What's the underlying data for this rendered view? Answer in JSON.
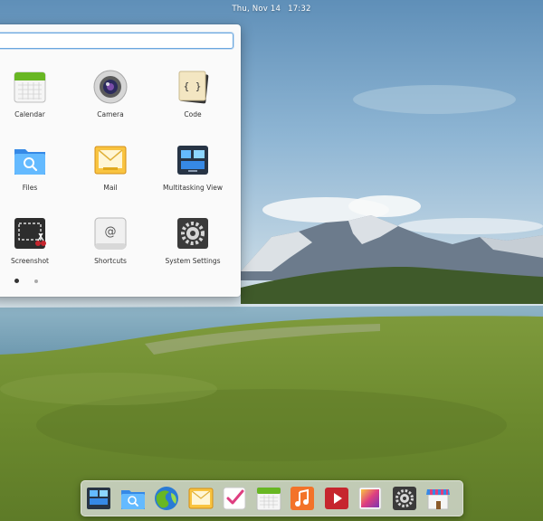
{
  "panel": {
    "date": "Thu, Nov 14",
    "time": "17:32"
  },
  "app_menu": {
    "search": {
      "value": "",
      "placeholder": ""
    },
    "apps": [
      {
        "label": "Calendar",
        "icon": "calendar-icon"
      },
      {
        "label": "Camera",
        "icon": "camera-icon"
      },
      {
        "label": "Code",
        "icon": "code-icon"
      },
      {
        "label": "Files",
        "icon": "files-icon"
      },
      {
        "label": "Mail",
        "icon": "mail-icon"
      },
      {
        "label": "Multitasking View",
        "icon": "multitasking-view-icon"
      },
      {
        "label": "Screenshot",
        "icon": "screenshot-icon"
      },
      {
        "label": "Shortcuts",
        "icon": "shortcuts-icon"
      },
      {
        "label": "System Settings",
        "icon": "system-settings-icon"
      }
    ],
    "pages": {
      "current": 1,
      "total": 2
    }
  },
  "dock": {
    "items": [
      "multitasking-view-icon",
      "files-icon",
      "web-browser-icon",
      "mail-icon",
      "tasks-icon",
      "calendar-icon",
      "music-icon",
      "videos-icon",
      "photos-icon",
      "system-settings-icon",
      "app-center-icon"
    ]
  },
  "colors": {
    "accent": "#3689e6",
    "menu_background": "#fafafa",
    "search_focus": "#6aa7df"
  }
}
